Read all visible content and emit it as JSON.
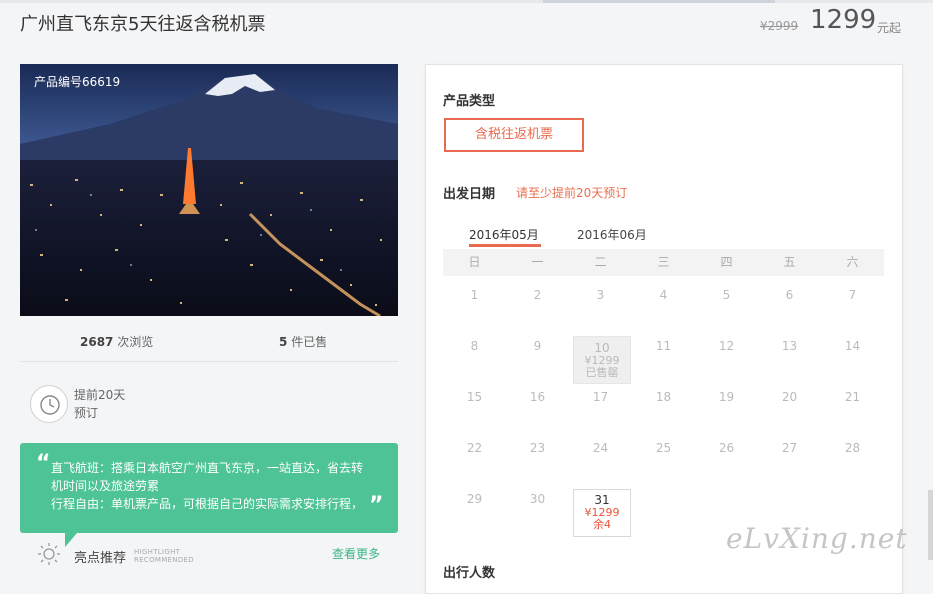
{
  "header": {
    "title": "广州直飞东京5天往返含税机票",
    "price_old": "¥2999",
    "price_now": "1299",
    "price_unit": "元起"
  },
  "photo": {
    "product_code": "产品编号66619"
  },
  "stats": {
    "views_count": "2687",
    "views_label": "次浏览",
    "sold_count": "5",
    "sold_label": "件已售"
  },
  "advance": {
    "line1": "提前20天",
    "line2": "预订"
  },
  "highlight_box": {
    "line1": "直飞航班：搭乘日本航空广州直飞东京，一站直达，省去转机时间以及旅途劳累",
    "line2": "行程自由：单机票产品，可根据自己的实际需求安排行程，"
  },
  "highlights": {
    "label": "亮点推荐",
    "en_line1": "HIGHTLIGHT",
    "en_line2": "RECOMMENDED",
    "more": "查看更多"
  },
  "booking": {
    "product_type_label": "产品类型",
    "product_type_option": "含税往返机票",
    "departure_label": "出发日期",
    "departure_hint": "请至少提前20天预订",
    "months": [
      "2016年05月",
      "2016年06月"
    ],
    "weekdays": [
      "日",
      "一",
      "二",
      "三",
      "四",
      "五",
      "六"
    ],
    "days": [
      [
        "1",
        "2",
        "3",
        "4",
        "5",
        "6",
        "7"
      ],
      [
        "8",
        "9",
        "",
        "11",
        "12",
        "13",
        "14"
      ],
      [
        "15",
        "16",
        "17",
        "18",
        "19",
        "20",
        "21"
      ],
      [
        "22",
        "23",
        "24",
        "25",
        "26",
        "27",
        "28"
      ],
      [
        "29",
        "30",
        "",
        "",
        "",
        "",
        ""
      ]
    ],
    "sold_cell": {
      "day": "10",
      "price": "¥1299",
      "status": "已售罄"
    },
    "available_cell": {
      "day": "31",
      "price": "¥1299",
      "remaining": "余4"
    },
    "travelers_label": "出行人数"
  },
  "watermark": "eLvXing.net",
  "colors": {
    "accent": "#e86a50",
    "green": "#4dc396"
  }
}
